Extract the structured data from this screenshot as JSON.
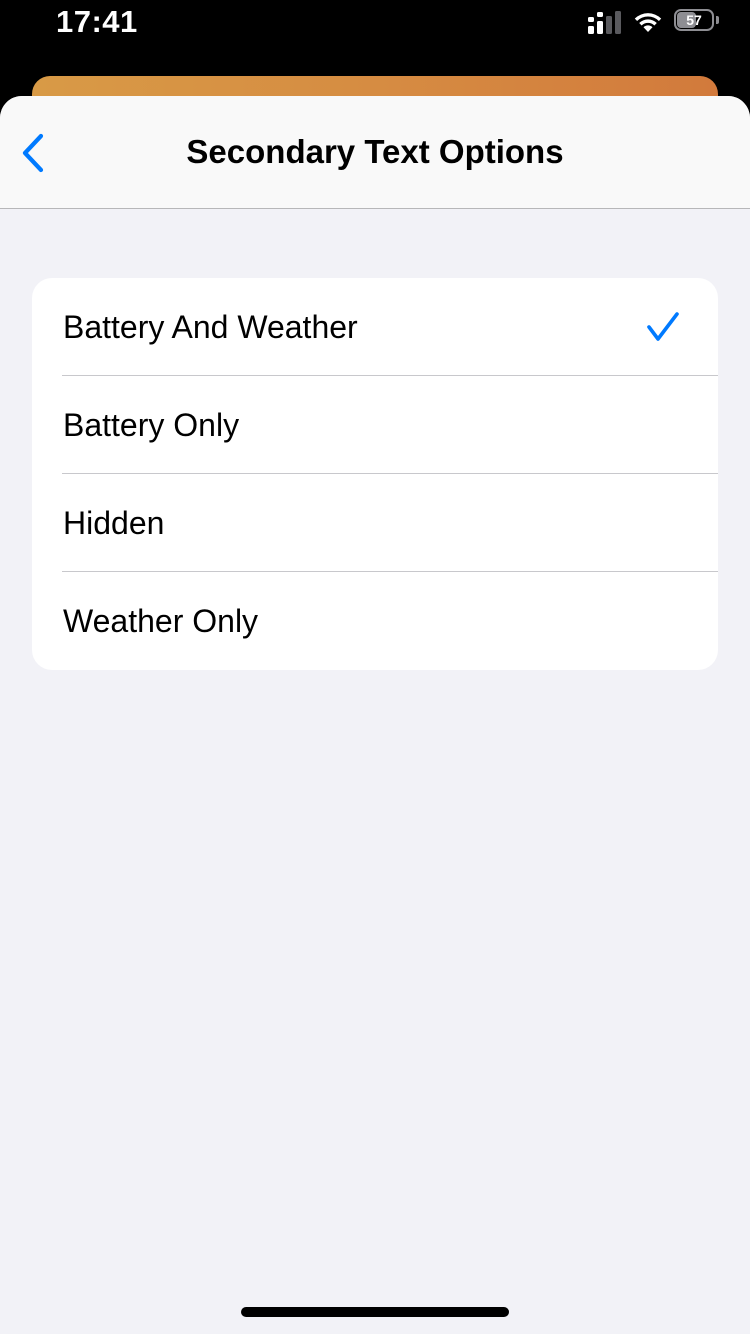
{
  "status_bar": {
    "time": "17:41",
    "battery_level": "57",
    "icons": [
      "signal-icon",
      "wifi-icon",
      "battery-icon"
    ]
  },
  "nav": {
    "title": "Secondary Text Options",
    "back_icon": "chevron-left-icon"
  },
  "options": [
    {
      "label": "Battery And Weather",
      "selected": true
    },
    {
      "label": "Battery Only",
      "selected": false
    },
    {
      "label": "Hidden",
      "selected": false
    },
    {
      "label": "Weather Only",
      "selected": false
    }
  ],
  "colors": {
    "accent": "#007aff",
    "background": "#f2f2f7",
    "card_gradient": [
      "#d89a46",
      "#d27a3c"
    ]
  }
}
